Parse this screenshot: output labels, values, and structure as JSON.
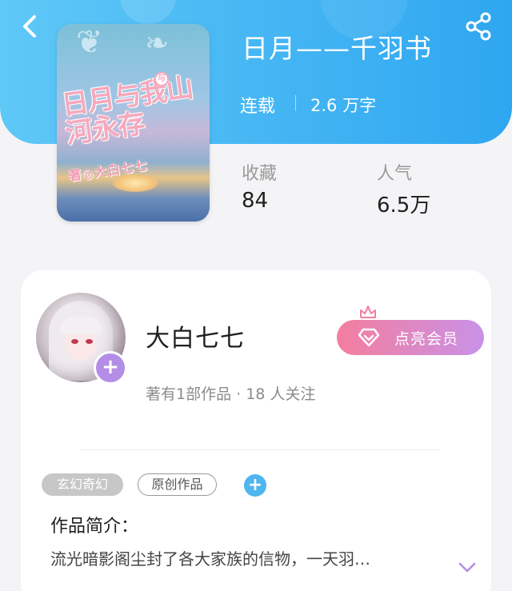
{
  "header": {
    "back_icon": "chevron-left-icon",
    "share_icon": "share-icon"
  },
  "book": {
    "title": "日月——千羽书",
    "status": "连载",
    "word_count": "2.6 万字",
    "cover": {
      "title_art": "日月与我山河永存",
      "author_art": "著◎大白七七",
      "badge_art": "与"
    },
    "stats": [
      {
        "label": "收藏",
        "value": "84"
      },
      {
        "label": "人气",
        "value": "6.5万"
      }
    ]
  },
  "author": {
    "name": "大白七七",
    "meta": "著有1部作品 · 18 人关注",
    "follow_label": "+",
    "vip_label": "点亮会员"
  },
  "tags": {
    "items": [
      "玄幻奇幻",
      "原创作品"
    ],
    "add_label": "+"
  },
  "intro": {
    "title": "作品简介：",
    "text": "流光暗影阁尘封了各大家族的信物，一天羽…"
  },
  "colors": {
    "header_gradient_start": "#5fc8f7",
    "header_gradient_end": "#2ea6f0",
    "vip_gradient_start": "#f47e9d",
    "vip_gradient_end": "#c991e8",
    "follow_purple": "#b48ee6",
    "tag_add_blue": "#4fb6ef"
  }
}
